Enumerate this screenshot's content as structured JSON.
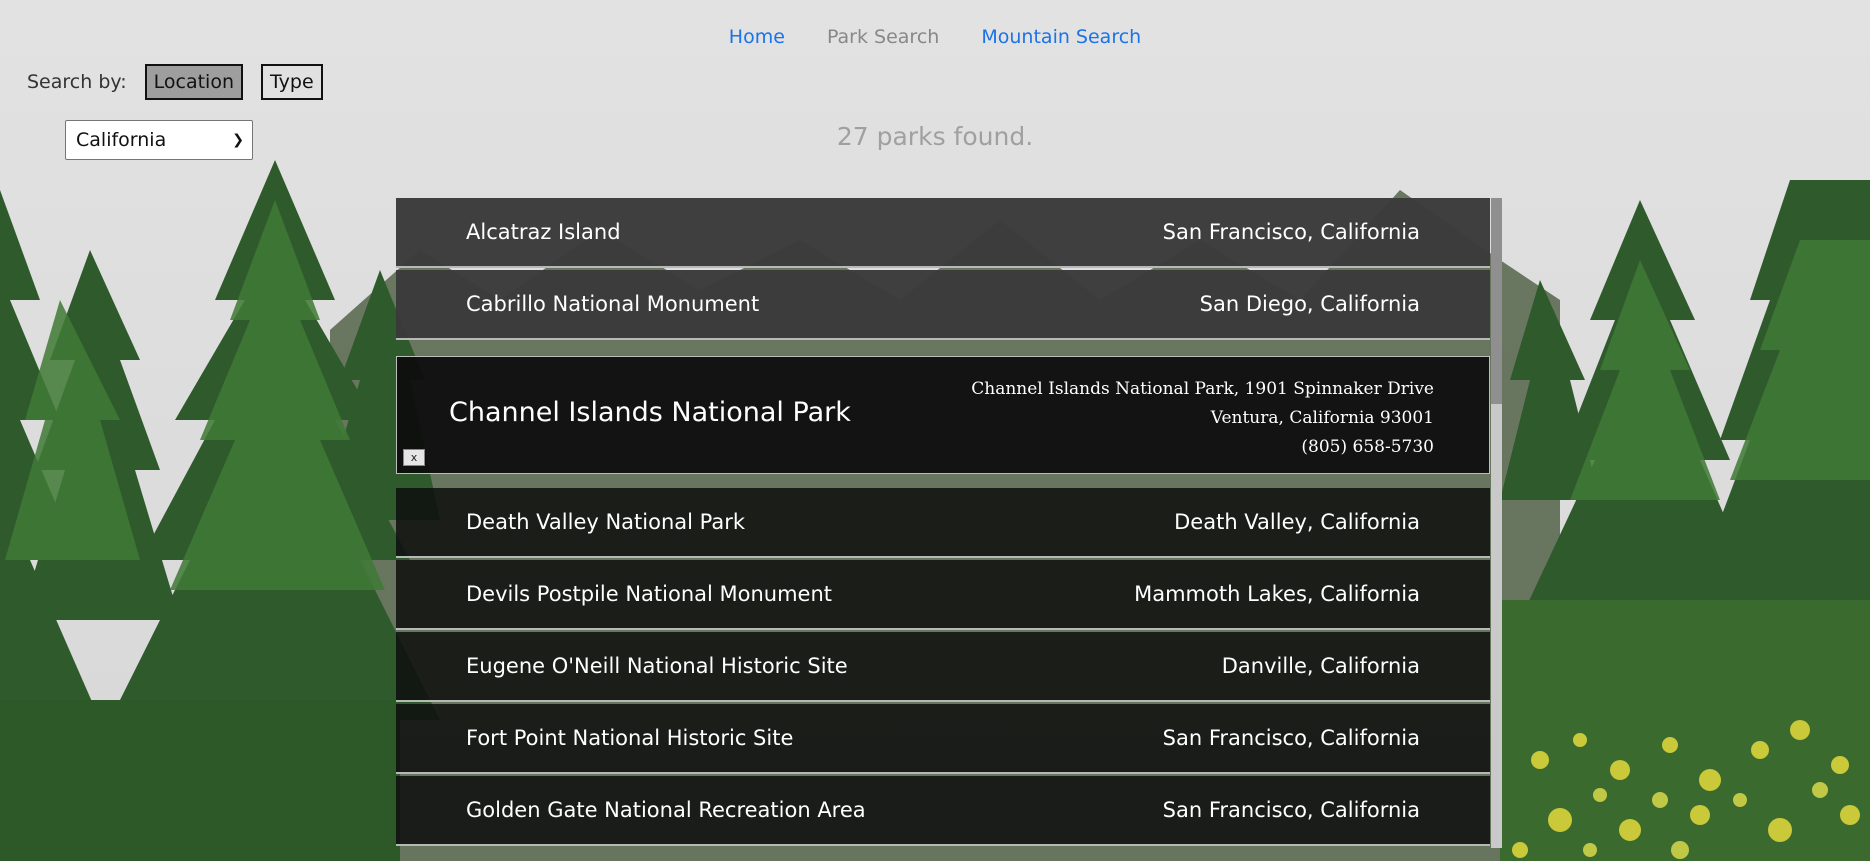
{
  "nav": {
    "home": "Home",
    "park_search": "Park Search",
    "mountain_search": "Mountain Search"
  },
  "search": {
    "label": "Search by:",
    "location_button": "Location",
    "type_button": "Type",
    "selected_state": "California"
  },
  "results_text": "27 parks found.",
  "parks": [
    {
      "name": "Alcatraz Island",
      "location": "San Francisco, California"
    },
    {
      "name": "Cabrillo National Monument",
      "location": "San Diego, California"
    },
    {
      "name": "Death Valley National Park",
      "location": "Death Valley, California"
    },
    {
      "name": "Devils Postpile National Monument",
      "location": "Mammoth Lakes, California"
    },
    {
      "name": "Eugene O'Neill National Historic Site",
      "location": "Danville, California"
    },
    {
      "name": "Fort Point National Historic Site",
      "location": "San Francisco, California"
    },
    {
      "name": "Golden Gate National Recreation Area",
      "location": "San Francisco, California"
    }
  ],
  "expanded": {
    "name": "Channel Islands National Park",
    "address_line1": "Channel Islands National Park, 1901 Spinnaker Drive",
    "address_line2": "Ventura, California 93001",
    "phone": "(805) 658-5730",
    "close_label": "x"
  },
  "colors": {
    "link": "#1a73e8",
    "active_nav": "#888888",
    "row_grey": "#3a3a3a",
    "row_dark": "#0e0e0e"
  }
}
